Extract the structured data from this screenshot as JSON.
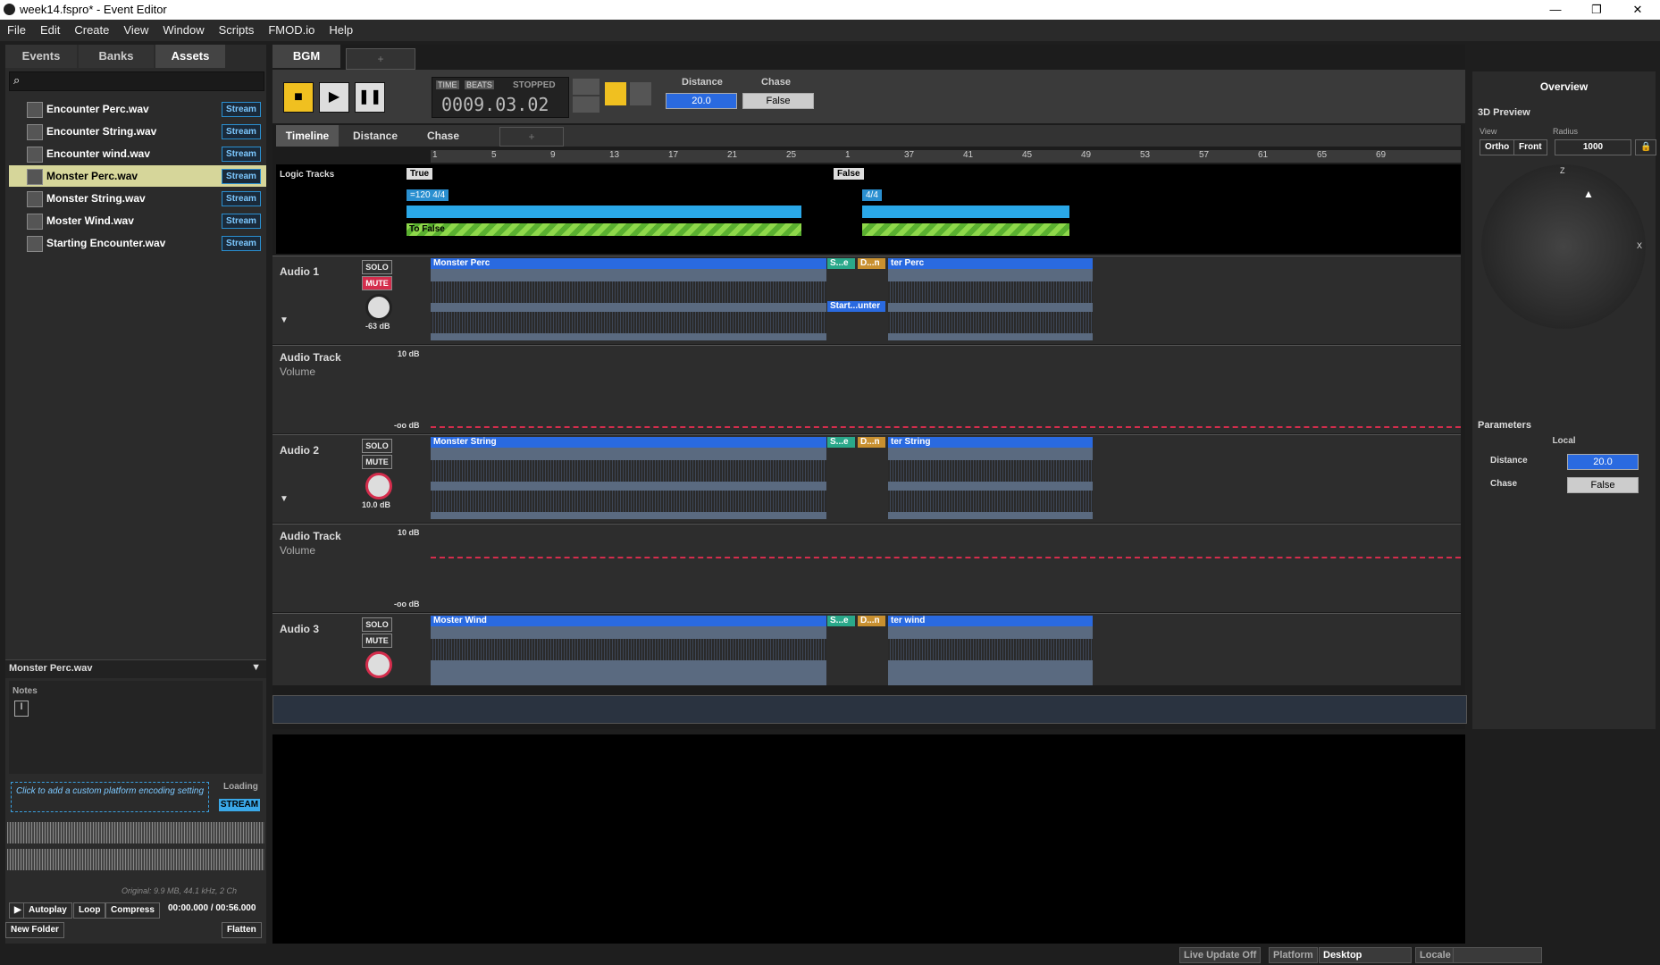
{
  "window": {
    "title": "week14.fspro* - Event Editor"
  },
  "menu": [
    "File",
    "Edit",
    "Create",
    "View",
    "Window",
    "Scripts",
    "FMOD.io",
    "Help"
  ],
  "left": {
    "tabs": [
      "Events",
      "Banks",
      "Assets"
    ],
    "assets": [
      {
        "name": "Encounter Perc.wav",
        "badge": "Stream"
      },
      {
        "name": "Encounter String.wav",
        "badge": "Stream"
      },
      {
        "name": "Encounter wind.wav",
        "badge": "Stream"
      },
      {
        "name": "Monster Perc.wav",
        "badge": "Stream"
      },
      {
        "name": "Monster String.wav",
        "badge": "Stream"
      },
      {
        "name": "Moster Wind.wav",
        "badge": "Stream"
      },
      {
        "name": "Starting Encounter.wav",
        "badge": "Stream"
      }
    ],
    "selected_name": "Monster Perc.wav",
    "notes_label": "Notes",
    "encoding_hint": "Click to add a custom platform encoding setting",
    "loading_label": "Loading",
    "stream_button": "STREAM",
    "original_info": "Original: 9.9 MB, 44.1 kHz, 2 Ch",
    "autoplay": "Autoplay",
    "loop": "Loop",
    "compress": "Compress",
    "time": "00:00.000 / 00:56.000",
    "new_folder": "New Folder",
    "flatten": "Flatten"
  },
  "event": {
    "tab": "BGM",
    "add_tab": "+",
    "time_mode": "TIME",
    "beats_mode": "BEATS",
    "status": "STOPPED",
    "position": "0009.03.02",
    "params": [
      {
        "name": "Distance",
        "value": "20.0"
      },
      {
        "name": "Chase",
        "value": "False"
      }
    ],
    "subtabs": [
      "Timeline",
      "Distance",
      "Chase",
      "+"
    ],
    "ruler": [
      "1",
      "5",
      "9",
      "13",
      "17",
      "21",
      "25",
      "1",
      "37",
      "41",
      "45",
      "49",
      "53",
      "57",
      "61",
      "65",
      "69"
    ],
    "logic_label": "Logic Tracks",
    "markers": {
      "true": "True",
      "false": "False",
      "tempo": "=120 4/4",
      "sig": "4/4",
      "transition": "To False"
    },
    "tracks": [
      {
        "name": "Audio 1",
        "solo": "SOLO",
        "mute": "MUTE",
        "db": "-63 dB",
        "clip1": "Monster Perc",
        "clip2": "S...e",
        "clip3": "D...n",
        "clip4": "ter Perc",
        "clip5": "Start...unter",
        "auto_name": "Audio Track",
        "auto_param": "Volume",
        "top_db": "10 dB",
        "bot_db": "-oo dB"
      },
      {
        "name": "Audio 2",
        "solo": "SOLO",
        "mute": "MUTE",
        "db": "10.0 dB",
        "clip1": "Monster String",
        "clip2": "S...e",
        "clip3": "D...n",
        "clip4": "ter String",
        "auto_name": "Audio Track",
        "auto_param": "Volume",
        "top_db": "10 dB",
        "bot_db": "-oo dB"
      },
      {
        "name": "Audio 3",
        "solo": "SOLO",
        "mute": "MUTE",
        "clip1": "Moster Wind",
        "clip2": "S...e",
        "clip3": "D...n",
        "clip4": "ter wind"
      }
    ]
  },
  "right": {
    "overview": "Overview",
    "preview": "3D Preview",
    "view_label": "View",
    "radius_label": "Radius",
    "ortho": "Ortho",
    "front": "Front",
    "radius": "1000",
    "z": "Z",
    "x": "X",
    "parameters": "Parameters",
    "local": "Local",
    "params": [
      {
        "name": "Distance",
        "value": "20.0"
      },
      {
        "name": "Chase",
        "value": "False"
      }
    ]
  },
  "status": {
    "live": "Live Update Off",
    "platform_label": "Platform",
    "platform": "Desktop",
    "locale_label": "Locale"
  }
}
